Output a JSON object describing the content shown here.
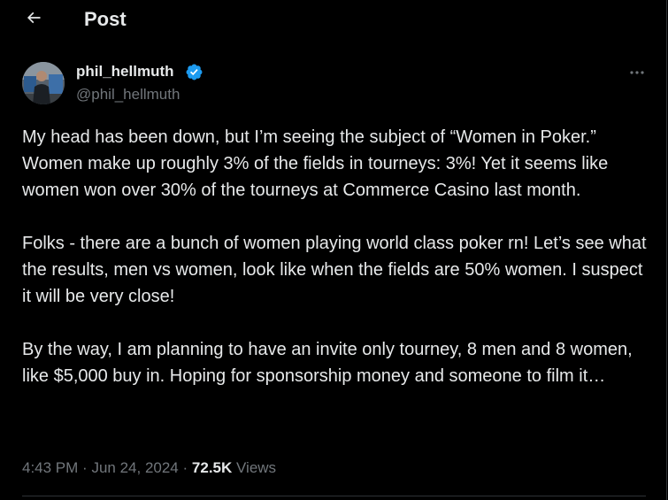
{
  "header": {
    "title": "Post",
    "back_icon": "arrow-left-icon"
  },
  "post": {
    "author_name": "phil_hellmuth",
    "handle": "@phil_hellmuth",
    "verified": true,
    "verified_color": "#1d9bf0",
    "more_icon": "more-horizontal-icon",
    "paragraphs": [
      "My head has been down, but I’m seeing the subject of “Women in Poker.” Women make up roughly 3% of the fields in tourneys: 3%! Yet it seems like women won over 30% of the tourneys at Commerce Casino last month.",
      "Folks - there are a bunch of women playing world class poker rn! Let’s see what the results, men vs women, look like when the fields are 50% women. I suspect it will be very close!",
      "By the way, I am planning to have an invite only tourney, 8 men and 8 women, like $5,000 buy in. Hoping for sponsorship money and someone to film it…"
    ],
    "time": "4:43 PM",
    "date": "Jun 24, 2024",
    "views_count": "72.5K",
    "views_label": "Views",
    "separator": "·"
  },
  "colors": {
    "background": "#000000",
    "text_primary": "#e7e9ea",
    "text_secondary": "#71767b",
    "border": "#2f3336"
  }
}
